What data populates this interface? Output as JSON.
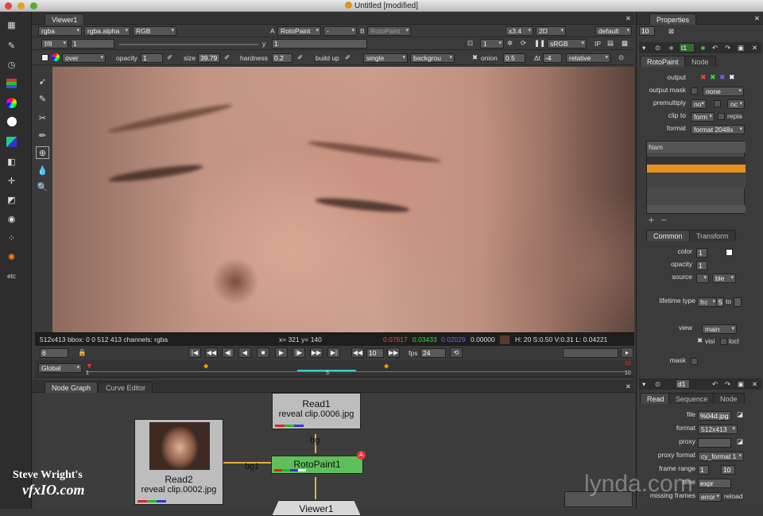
{
  "window": {
    "title": "Untitled [modified]"
  },
  "viewer": {
    "tab": "Viewer1",
    "row1": {
      "channels": "rgba",
      "alpha": "rgba.alpha",
      "colorspace": "RGB",
      "a_label": "A",
      "a_node": "RotoPaint",
      "a_dash": "-",
      "b_label": "B",
      "b_node": "RotoPaint",
      "zoom": "x3.4",
      "view": "2D",
      "lut": "default"
    },
    "row2": {
      "fstop": "f/8",
      "gain": "1",
      "y_label": "y",
      "gamma": "1",
      "proxy": "1",
      "display": "sRGB",
      "ip": "IP"
    },
    "row3": {
      "blend": "over",
      "opacity_label": "opacity",
      "opacity": "1",
      "size_label": "size",
      "size": "39.79",
      "hardness_label": "hardness",
      "hardness": "0.2",
      "buildup_label": "build up",
      "mode": "single",
      "source": "backgrou",
      "onion_label": "onion",
      "onion": "0.5",
      "dt_label": "Δt",
      "dt": "-4",
      "relative": "relative"
    },
    "info": {
      "format": "512x413 bbox: 0 0 512 413 channels: rgba",
      "coords": "x= 321 y= 140",
      "r": "0.07617",
      "g": "0.03433",
      "b": "0.02029",
      "a": "0.00000",
      "hsv": "H: 20 S:0.50 V:0.31  L: 0.04221"
    },
    "transport": {
      "frame": "6",
      "step": "10",
      "fps_label": "fps",
      "fps": "24"
    },
    "timeline": {
      "range": "Global",
      "start": "1",
      "mid": "5",
      "end": "10",
      "end_top": "10"
    }
  },
  "nodegraph": {
    "tabs": [
      "Node Graph",
      "Curve Editor"
    ],
    "nodes": {
      "read1": {
        "title": "Read1",
        "file": "reveal clip.0006.jpg"
      },
      "read2": {
        "title": "Read2",
        "file": "reveal clip.0002.jpg"
      },
      "roto": {
        "title": "RotoPaint1",
        "badge": "A"
      },
      "viewer": {
        "title": "Viewer1"
      }
    },
    "pipes": {
      "bg": "bg",
      "bg1": "bg1"
    }
  },
  "properties": {
    "title": "Properties",
    "count": "10",
    "node_name": "t1",
    "tabs": [
      "RotoPaint",
      "Node"
    ],
    "fields": {
      "output": "output",
      "output_mask": "output mask",
      "output_mask_val": "none",
      "premultiply": "premultiply",
      "premultiply_val": "no",
      "clip_to": "clip to",
      "clip_to_val": "form",
      "replace": "repla",
      "format": "format",
      "format_val": "format 2048x"
    },
    "layers_header": "Nam",
    "subtabs": [
      "Common",
      "Transform"
    ],
    "common": {
      "color": "color",
      "color_val": "1",
      "opacity": "opacity",
      "opacity_val": "1",
      "source": "source",
      "source_val": "ble",
      "lifetime": "lifetime type",
      "lifetime_val": "frc",
      "lifetime_from": "5",
      "lifetime_to_lbl": "to",
      "view": "view",
      "view_val": "main",
      "visible": "visi",
      "locked": "locl",
      "mask": "mask"
    },
    "read": {
      "node_name": "d1",
      "tabs": [
        "Read",
        "Sequence",
        "Node"
      ],
      "file": "file",
      "file_val": "%04d.jpg",
      "format": "format",
      "format_val": "512x413",
      "proxy": "proxy",
      "proxy_format": "proxy format",
      "proxy_format_val": "cy_format 1",
      "frame_range": "frame range",
      "fr_start": "1",
      "fr_end": "10",
      "time": "time",
      "time_val": "expr",
      "missing": "missing frames",
      "missing_val": "error",
      "reload": "reload"
    }
  },
  "watermark": {
    "line1": "Steve Wright's",
    "line2": "vfxIO.com",
    "brand": "lynda.com"
  }
}
